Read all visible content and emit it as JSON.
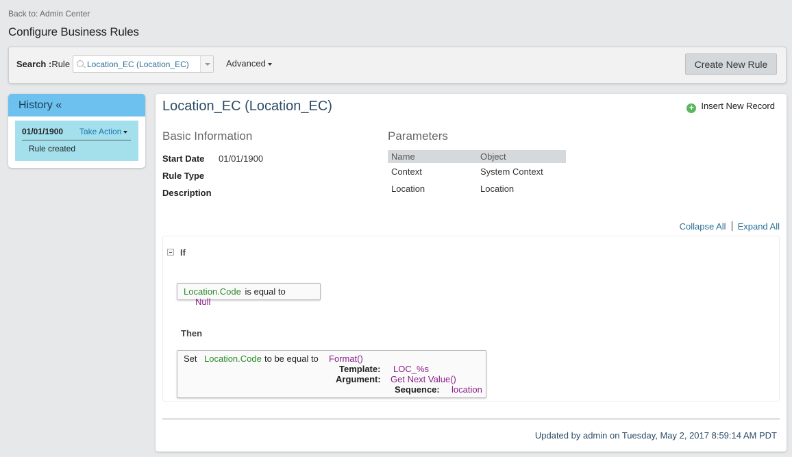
{
  "nav": {
    "back": "Back to: Admin Center"
  },
  "page": {
    "title": "Configure Business Rules"
  },
  "search": {
    "label": "Search :",
    "rule_label": "Rule",
    "value": "Location_EC (Location_EC)",
    "advanced": "Advanced",
    "create_button": "Create New Rule"
  },
  "history": {
    "title": "History «",
    "entries": [
      {
        "date": "01/01/1900",
        "action": "Take Action",
        "note": "Rule created"
      }
    ]
  },
  "rule": {
    "title": "Location_EC (Location_EC)",
    "insert_record": "Insert New Record",
    "basic_info": {
      "heading": "Basic Information",
      "start_date_label": "Start Date",
      "start_date": "01/01/1900",
      "rule_type_label": "Rule Type",
      "description_label": "Description"
    },
    "parameters": {
      "heading": "Parameters",
      "columns": [
        "Name",
        "Object"
      ],
      "rows": [
        [
          "Context",
          "System Context"
        ],
        [
          "Location",
          "Location"
        ]
      ]
    },
    "collapse_all": "Collapse All",
    "expand_all": "Expand All",
    "if_label": "If",
    "condition": {
      "field": "Location.Code",
      "op": "is equal to",
      "value": "Null"
    },
    "then_label": "Then",
    "action": {
      "verb": "Set",
      "field": "Location.Code",
      "op": "to be equal to",
      "func": "Format()",
      "template_label": "Template:",
      "template_value": "LOC_%s",
      "argument_label": "Argument:",
      "argument_value": "Get Next Value()",
      "sequence_label": "Sequence:",
      "sequence_value": "location"
    },
    "updated": "Updated by admin on Tuesday, May 2, 2017 8:59:14 AM PDT"
  },
  "colors": {
    "history_header": "#6cc1ee",
    "history_entry": "#a4e0ec",
    "field_green": "#2a8a2a",
    "value_purple": "#8a1f8a",
    "link_blue": "#2a6f97"
  }
}
